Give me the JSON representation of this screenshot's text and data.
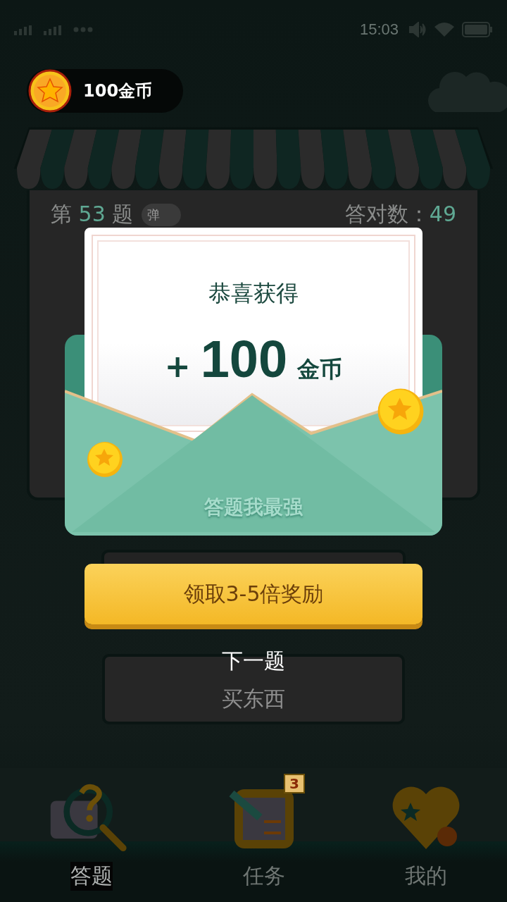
{
  "status_bar": {
    "time": "15:03"
  },
  "coin_balance": {
    "label": "100金币"
  },
  "quiz": {
    "number_prefix": "第",
    "number": "53",
    "number_suffix": "题",
    "toggle": {
      "label": "弹",
      "on": false
    },
    "correct_label": "答对数：",
    "correct_count": "49"
  },
  "answer_options": [
    {
      "label": "买东西"
    }
  ],
  "tabs": [
    {
      "label": "答题",
      "selected": true
    },
    {
      "label": "任务",
      "selected": false,
      "badge": "3"
    },
    {
      "label": "我的",
      "selected": false
    }
  ],
  "popup": {
    "title": "恭喜获得",
    "sign": "+",
    "amount": "100",
    "unit": "金币",
    "envelope_text": "答题我最强",
    "claim_button": "领取3-5倍奖励",
    "next_button": "下一题"
  }
}
